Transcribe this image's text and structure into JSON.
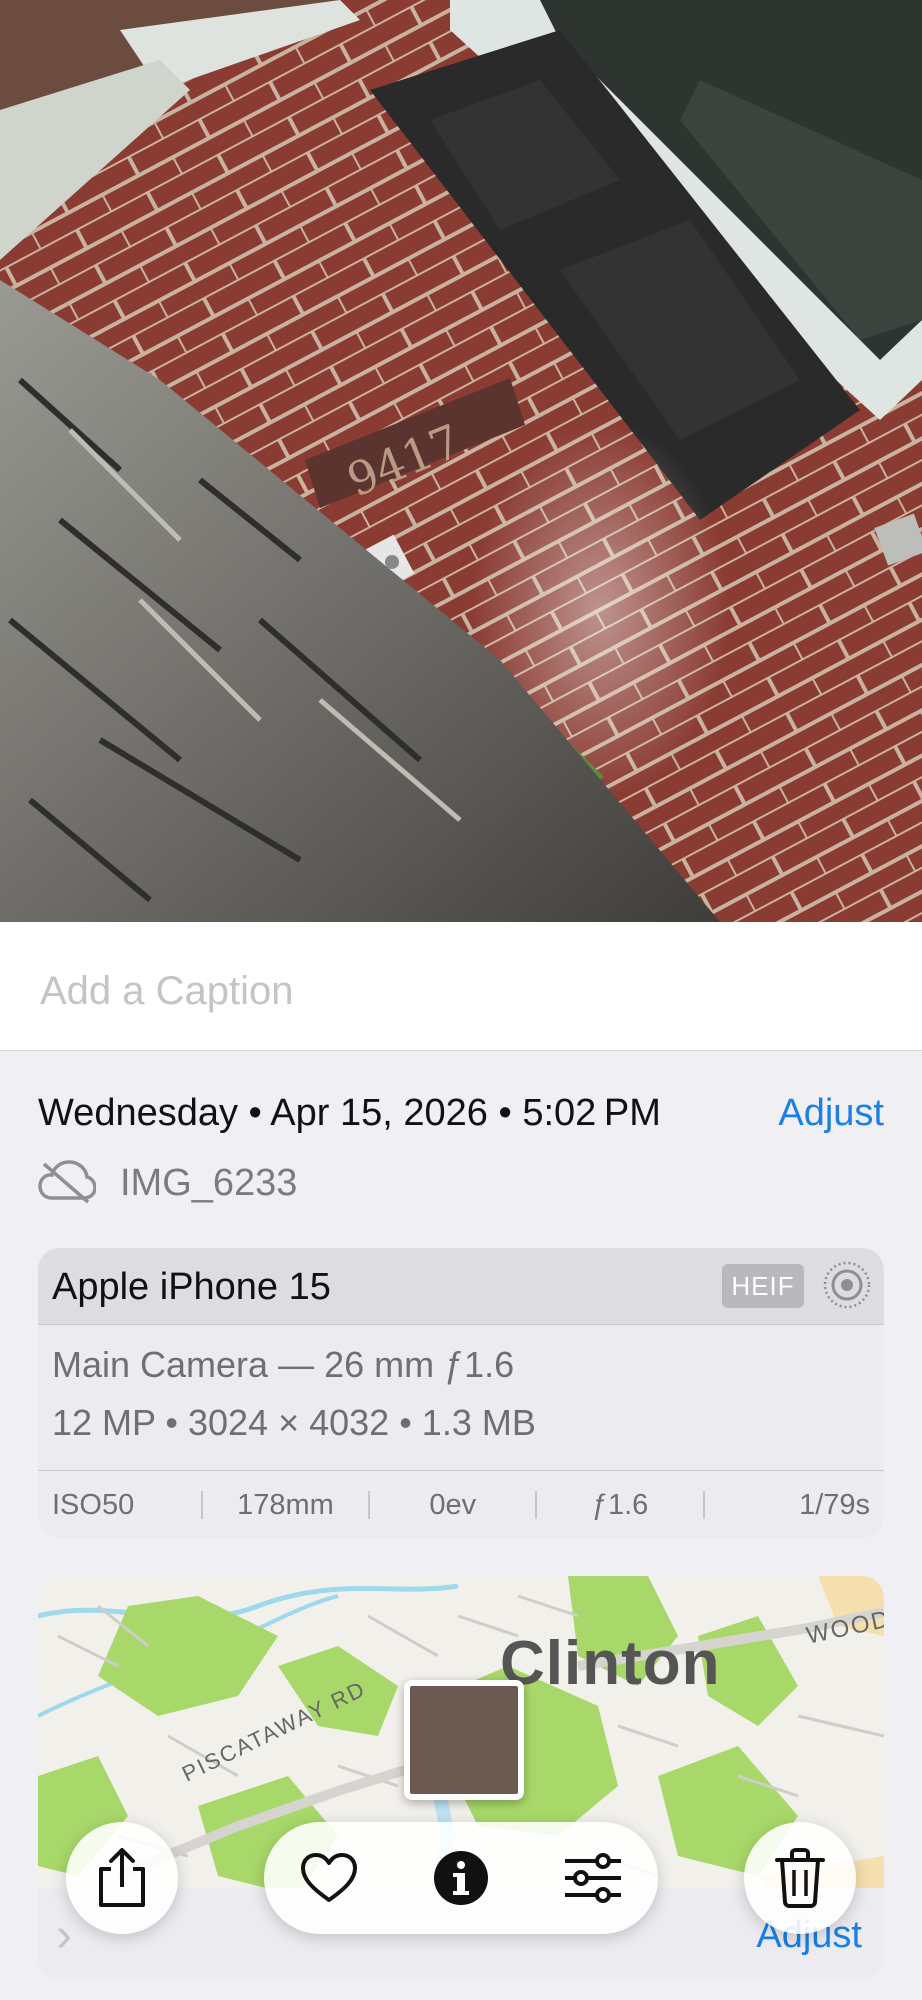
{
  "caption": {
    "placeholder": "Add a Caption"
  },
  "info": {
    "date_text": "Wednesday • Apr 15, 2026 • 5:02 PM",
    "adjust_label": "Adjust",
    "file_name": "IMG_6233"
  },
  "camera": {
    "device": "Apple iPhone 15",
    "format_badge": "HEIF",
    "lens": "Main Camera — 26 mm ƒ1.6",
    "specs": "12 MP • 3024 × 4032 • 1.3 MB",
    "exif": [
      "ISO50",
      "178mm",
      "0ev",
      "ƒ1.6",
      "1/79s"
    ]
  },
  "map": {
    "place": "Clinton",
    "road_1": "PISCATAWAY RD",
    "road_2": "WOOD",
    "adjust_label": "Adjust"
  },
  "toolbar": {
    "icons": [
      "share-icon",
      "heart-icon",
      "info-icon",
      "adjustments-icon",
      "trash-icon"
    ]
  },
  "colors": {
    "accent": "#1a7fe6",
    "background": "#efeff4"
  }
}
